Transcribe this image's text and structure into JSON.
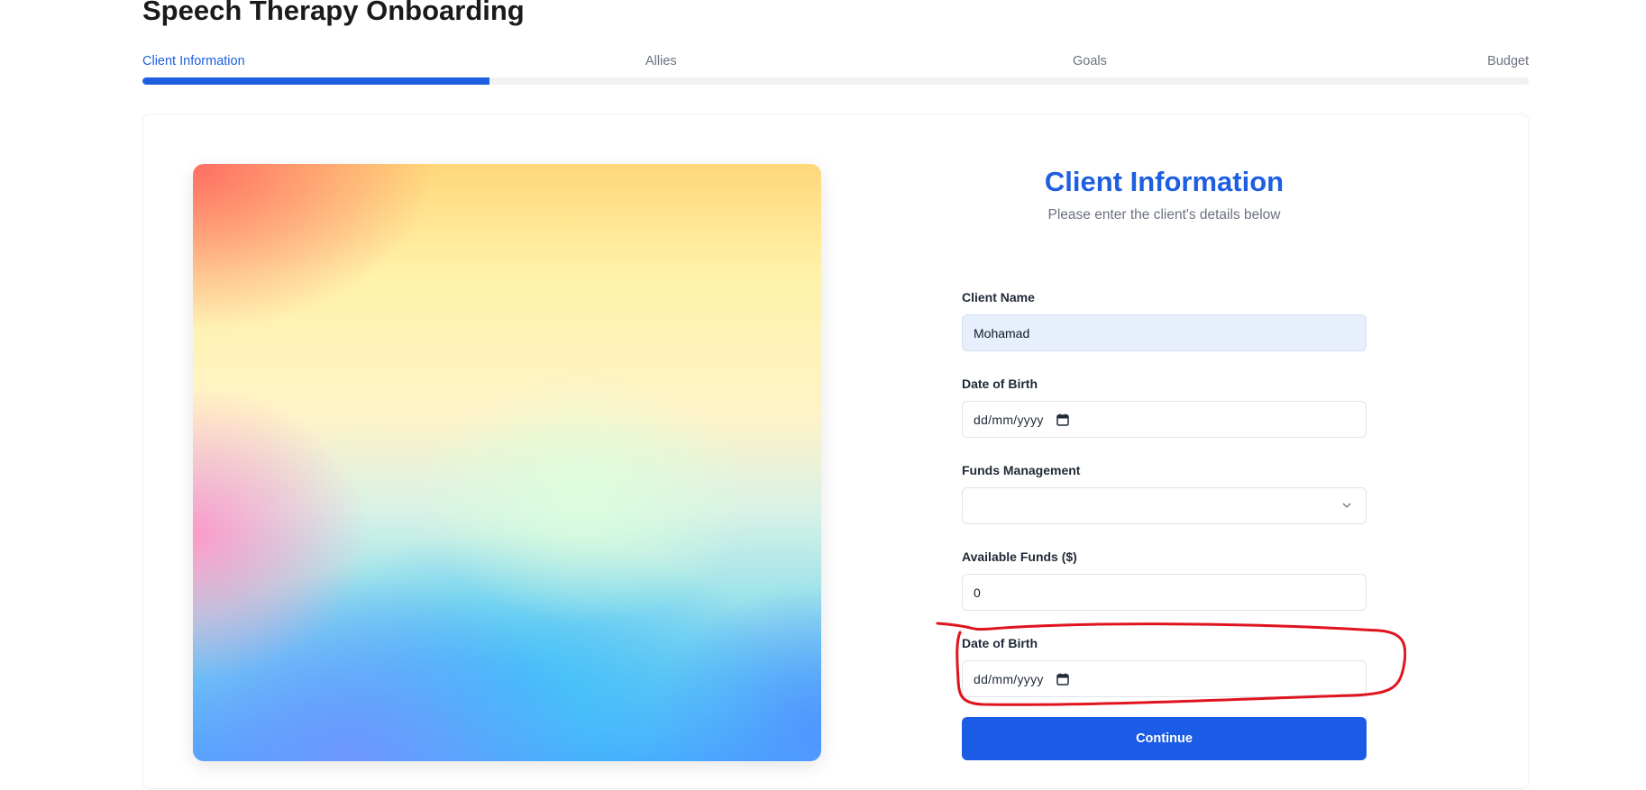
{
  "app": {
    "title": "Speech Therapy Onboarding"
  },
  "stepper": {
    "steps": [
      {
        "label": "Client Information",
        "active": true
      },
      {
        "label": "Allies",
        "active": false
      },
      {
        "label": "Goals",
        "active": false
      },
      {
        "label": "Budget",
        "active": false
      }
    ],
    "progress_fraction": 0.25
  },
  "form": {
    "title": "Client Information",
    "subtitle": "Please enter the client's details below",
    "client_name": {
      "label": "Client Name",
      "value": "Mohamad"
    },
    "date_of_birth": {
      "label": "Date of Birth",
      "placeholder": "dd/mm/yyyy"
    },
    "funds_management": {
      "label": "Funds Management",
      "value": ""
    },
    "available_funds": {
      "label": "Available Funds ($)",
      "value": "0"
    },
    "date_of_birth_2": {
      "label": "Date of Birth",
      "placeholder": "dd/mm/yyyy"
    },
    "continue_label": "Continue"
  },
  "colors": {
    "accent": "#1d5fe0",
    "annotation": "#e0141e",
    "filled_input": "#e8effc"
  },
  "icons": {
    "calendar": "calendar-icon",
    "select_chevron": "chevron-down-icon"
  }
}
